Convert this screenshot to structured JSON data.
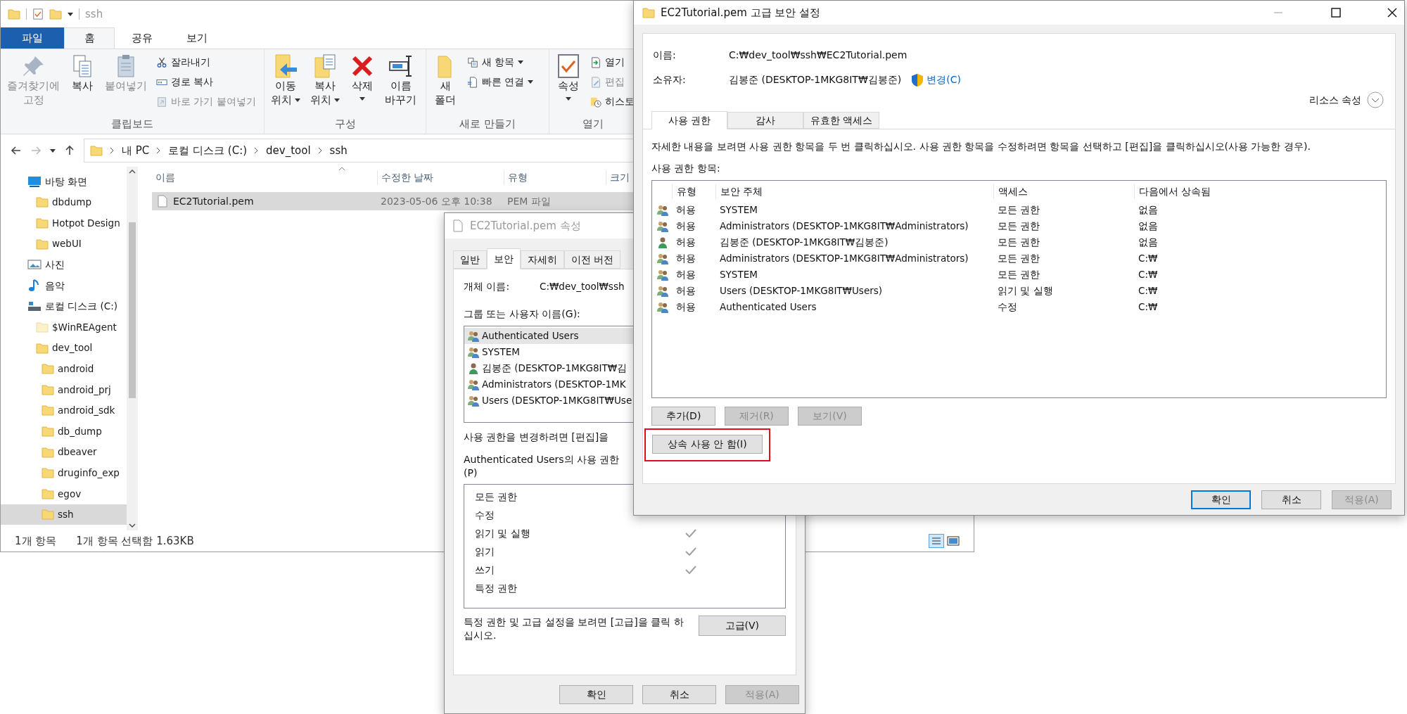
{
  "explorer": {
    "title": "ssh",
    "ribbon_tabs": [
      {
        "label": "파일",
        "kind": "file",
        "selected": false
      },
      {
        "label": "홈",
        "kind": "tab",
        "selected": true
      },
      {
        "label": "공유",
        "kind": "tab",
        "selected": false
      },
      {
        "label": "보기",
        "kind": "tab",
        "selected": false
      }
    ],
    "ribbon_groups": [
      {
        "label": "클립보드",
        "large": [
          {
            "label": "즐겨찾기에\n고정",
            "disabled": true,
            "dropdown": false
          },
          {
            "label": "복사",
            "disabled": false,
            "dropdown": false
          },
          {
            "label": "붙여넣기",
            "disabled": true,
            "dropdown": false
          }
        ],
        "small": [
          {
            "label": "잘라내기",
            "disabled": false,
            "dropdown": false
          },
          {
            "label": "경로 복사",
            "disabled": false,
            "dropdown": false
          },
          {
            "label": "바로 가기 붙여넣기",
            "disabled": true,
            "dropdown": false
          }
        ]
      },
      {
        "label": "구성",
        "large": [
          {
            "label": "이동\n위치",
            "disabled": false,
            "dropdown": true
          },
          {
            "label": "복사\n위치",
            "disabled": false,
            "dropdown": true
          },
          {
            "label": "삭제",
            "disabled": false,
            "dropdown": true
          },
          {
            "label": "이름\n바꾸기",
            "disabled": false,
            "dropdown": false
          }
        ]
      },
      {
        "label": "새로 만들기",
        "large": [
          {
            "label": "새\n폴더",
            "disabled": false,
            "dropdown": false
          }
        ],
        "small": [
          {
            "label": "새 항목",
            "disabled": false,
            "dropdown": true
          },
          {
            "label": "빠른 연결",
            "disabled": false,
            "dropdown": true
          }
        ]
      },
      {
        "label": "열기",
        "large": [
          {
            "label": "속성",
            "disabled": false,
            "dropdown": true
          }
        ],
        "small": [
          {
            "label": "열기",
            "disabled": false,
            "dropdown": false
          },
          {
            "label": "편집",
            "disabled": true,
            "dropdown": false
          },
          {
            "label": "히스토",
            "disabled": false,
            "dropdown": false
          }
        ]
      }
    ],
    "breadcrumbs": [
      "내 PC",
      "로컬 디스크 (C:)",
      "dev_tool",
      "ssh"
    ],
    "nav_tree": [
      {
        "label": "바탕 화면",
        "kind": "desktop",
        "selected": false,
        "children": [
          {
            "label": "dbdump",
            "kind": "folder",
            "selected": false
          },
          {
            "label": "Hotpot Design",
            "kind": "folder",
            "selected": false
          },
          {
            "label": "webUI",
            "kind": "folder",
            "selected": false
          }
        ]
      },
      {
        "label": "사진",
        "kind": "pictures",
        "selected": false
      },
      {
        "label": "음악",
        "kind": "music",
        "selected": false
      },
      {
        "label": "로컬 디스크 (C:)",
        "kind": "drive",
        "selected": false,
        "children": [
          {
            "label": "$WinREAgent",
            "kind": "hidden-folder",
            "selected": false
          },
          {
            "label": "dev_tool",
            "kind": "folder",
            "selected": false,
            "children": [
              {
                "label": "android",
                "kind": "folder",
                "selected": false
              },
              {
                "label": "android_prj",
                "kind": "folder",
                "selected": false
              },
              {
                "label": "android_sdk",
                "kind": "folder",
                "selected": false
              },
              {
                "label": "db_dump",
                "kind": "folder",
                "selected": false
              },
              {
                "label": "dbeaver",
                "kind": "folder",
                "selected": false
              },
              {
                "label": "druginfo_exp",
                "kind": "folder",
                "selected": false
              },
              {
                "label": "egov",
                "kind": "folder",
                "selected": false
              },
              {
                "label": "ssh",
                "kind": "folder",
                "selected": true
              }
            ]
          }
        ]
      }
    ],
    "columns": [
      "이름",
      "수정한 날짜",
      "유형",
      "크기"
    ],
    "files": [
      {
        "name": "EC2Tutorial.pem",
        "modified": "2023-05-06 오후 10:38",
        "type": "PEM 파일",
        "selected": true
      }
    ],
    "status": [
      "1개 항목",
      "1개 항목 선택함 1.63KB"
    ]
  },
  "properties": {
    "title": "EC2Tutorial.pem 속성",
    "tabs": [
      {
        "label": "일반",
        "selected": false
      },
      {
        "label": "보안",
        "selected": true
      },
      {
        "label": "자세히",
        "selected": false
      },
      {
        "label": "이전 버전",
        "selected": false
      }
    ],
    "object_label": "개체 이름:",
    "object_value": "C:₩dev_tool₩ssh",
    "users_label": "그룹 또는 사용자 이름(G):",
    "users": [
      {
        "name": "Authenticated Users",
        "kind": "group",
        "selected": true
      },
      {
        "name": "SYSTEM",
        "kind": "group",
        "selected": false
      },
      {
        "name": "김봉준 (DESKTOP-1MKG8IT₩김",
        "kind": "user",
        "selected": false
      },
      {
        "name": "Administrators (DESKTOP-1MK",
        "kind": "group",
        "selected": false
      },
      {
        "name": "Users (DESKTOP-1MKG8IT₩Use",
        "kind": "group",
        "selected": false
      }
    ],
    "edit_hint": "사용 권한을 변경하려면 [편집]을",
    "perm_label": "Authenticated Users의 사용 권한\n(P)",
    "permissions": [
      {
        "name": "모든 권한",
        "checked": false
      },
      {
        "name": "수정",
        "checked": false
      },
      {
        "name": "읽기 및 실행",
        "checked": true
      },
      {
        "name": "읽기",
        "checked": true
      },
      {
        "name": "쓰기",
        "checked": true
      },
      {
        "name": "특정 권한",
        "checked": false
      }
    ],
    "advanced_hint": "특정 권한 및 고급 설정을 보려면 [고급]을 클릭 하십시오.",
    "advanced_button": "고급(V)",
    "buttons": [
      {
        "label": "확인",
        "disabled": false
      },
      {
        "label": "취소",
        "disabled": false
      },
      {
        "label": "적용(A)",
        "disabled": true
      }
    ]
  },
  "advanced": {
    "title": "EC2Tutorial.pem 고급 보안 설정",
    "name_label": "이름:",
    "name_value": "C:₩dev_tool₩ssh₩EC2Tutorial.pem",
    "owner_label": "소유자:",
    "owner_value": "김봉준 (DESKTOP-1MKG8IT₩김봉준)",
    "change_link": "변경(C)",
    "resource_label": "리소스 속성",
    "tabs": [
      {
        "label": "사용 권한",
        "selected": true
      },
      {
        "label": "감사",
        "selected": false
      },
      {
        "label": "유효한 액세스",
        "selected": false
      }
    ],
    "description": "자세한 내용을 보려면 사용 권한 항목을 두 번 클릭하십시오. 사용 권한 항목을 수정하려면 항목을 선택하고 [편집]을 클릭하십시오(사용 가능한 경우).",
    "entries_label": "사용 권한 항목:",
    "columns": [
      "유형",
      "보안 주체",
      "액세스",
      "다음에서 상속됨"
    ],
    "entries": [
      {
        "kind": "group",
        "type": "허용",
        "principal": "SYSTEM",
        "access": "모든 권한",
        "inherited_from": "없음"
      },
      {
        "kind": "group",
        "type": "허용",
        "principal": "Administrators (DESKTOP-1MKG8IT₩Administrators)",
        "access": "모든 권한",
        "inherited_from": "없음"
      },
      {
        "kind": "user",
        "type": "허용",
        "principal": "김봉준 (DESKTOP-1MKG8IT₩김봉준)",
        "access": "모든 권한",
        "inherited_from": "없음"
      },
      {
        "kind": "group",
        "type": "허용",
        "principal": "Administrators (DESKTOP-1MKG8IT₩Administrators)",
        "access": "모든 권한",
        "inherited_from": "C:₩"
      },
      {
        "kind": "group",
        "type": "허용",
        "principal": "SYSTEM",
        "access": "모든 권한",
        "inherited_from": "C:₩"
      },
      {
        "kind": "group",
        "type": "허용",
        "principal": "Users (DESKTOP-1MKG8IT₩Users)",
        "access": "읽기 및 실행",
        "inherited_from": "C:₩"
      },
      {
        "kind": "group",
        "type": "허용",
        "principal": "Authenticated Users",
        "access": "수정",
        "inherited_from": "C:₩"
      }
    ],
    "entry_buttons": [
      {
        "label": "추가(D)",
        "disabled": false
      },
      {
        "label": "제거(R)",
        "disabled": true
      },
      {
        "label": "보기(V)",
        "disabled": true
      }
    ],
    "disable_inheritance": {
      "label": "상속 사용 안 함(I)",
      "highlighted": true
    },
    "buttons": [
      {
        "label": "확인",
        "disabled": false,
        "default": true
      },
      {
        "label": "취소",
        "disabled": false,
        "default": false
      },
      {
        "label": "적용(A)",
        "disabled": true,
        "default": false
      }
    ]
  }
}
